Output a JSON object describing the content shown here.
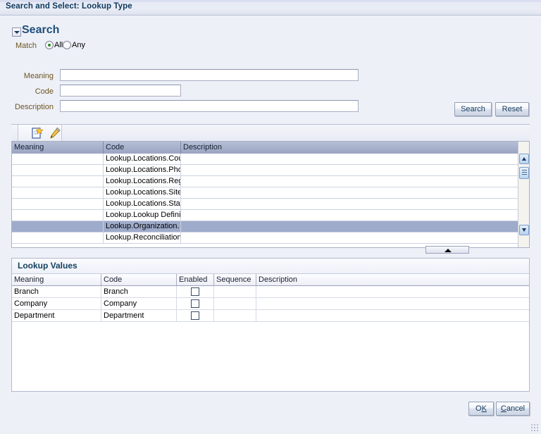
{
  "window": {
    "title": "Search and Select: Lookup Type"
  },
  "search": {
    "heading": "Search",
    "disclosure_icon": "chevron-down-icon",
    "match_label": "Match",
    "options": [
      {
        "label": "All",
        "selected": true
      },
      {
        "label": "Any",
        "selected": false
      }
    ],
    "fields": [
      {
        "label": "Meaning",
        "value": "",
        "placeholder": ""
      },
      {
        "label": "Code",
        "value": "",
        "placeholder": ""
      },
      {
        "label": "Description",
        "value": "",
        "placeholder": ""
      }
    ],
    "search_button": "Search",
    "reset_button": "Reset"
  },
  "results": {
    "toolbar": [
      {
        "icon": "create-new-icon"
      },
      {
        "icon": "edit-pencil-icon"
      }
    ],
    "columns": [
      "Meaning",
      "Code",
      "Description"
    ],
    "rows": [
      {
        "meaning": "",
        "code": "Lookup.Locations.Cou",
        "description": "",
        "selected": false
      },
      {
        "meaning": "",
        "code": "Lookup.Locations.Pho",
        "description": "",
        "selected": false
      },
      {
        "meaning": "",
        "code": "Lookup.Locations.Reg",
        "description": "",
        "selected": false
      },
      {
        "meaning": "",
        "code": "Lookup.Locations.Site",
        "description": "",
        "selected": false
      },
      {
        "meaning": "",
        "code": "Lookup.Locations.Sta",
        "description": "",
        "selected": false
      },
      {
        "meaning": "",
        "code": "Lookup.Lookup Defini",
        "description": "",
        "selected": false
      },
      {
        "meaning": "",
        "code": "Lookup.Organization.",
        "description": "",
        "selected": true
      },
      {
        "meaning": "",
        "code": "Lookup.Reconciliation",
        "description": "",
        "selected": false
      }
    ],
    "scrollbar": {
      "up_icon": "scroll-up-icon",
      "down_icon": "scroll-down-icon",
      "thumb_icon": "scroll-thumb-icon"
    },
    "splitter_icon": "collapse-up-icon"
  },
  "lookup_values": {
    "title": "Lookup Values",
    "columns": [
      "Meaning",
      "Code",
      "Enabled",
      "Sequence",
      "Description"
    ],
    "rows": [
      {
        "meaning": "Branch",
        "code": "Branch",
        "enabled": false,
        "sequence": "",
        "description": ""
      },
      {
        "meaning": "Company",
        "code": "Company",
        "enabled": false,
        "sequence": "",
        "description": ""
      },
      {
        "meaning": "Department",
        "code": "Department",
        "enabled": false,
        "sequence": "",
        "description": ""
      }
    ]
  },
  "footer": {
    "ok_button": "OK",
    "ok_accesskey": "K",
    "cancel_button": "Cancel",
    "cancel_accesskey": "C",
    "resize_grip_icon": "resize-grip-icon"
  },
  "colors": {
    "window_background": "#eef0f8",
    "title_text": "#0e3a5e",
    "label_text": "#6b5520",
    "grid_header": "#9aa5c2",
    "selected_row": "#9eabca",
    "radio_selected": "#2c8a2c"
  }
}
